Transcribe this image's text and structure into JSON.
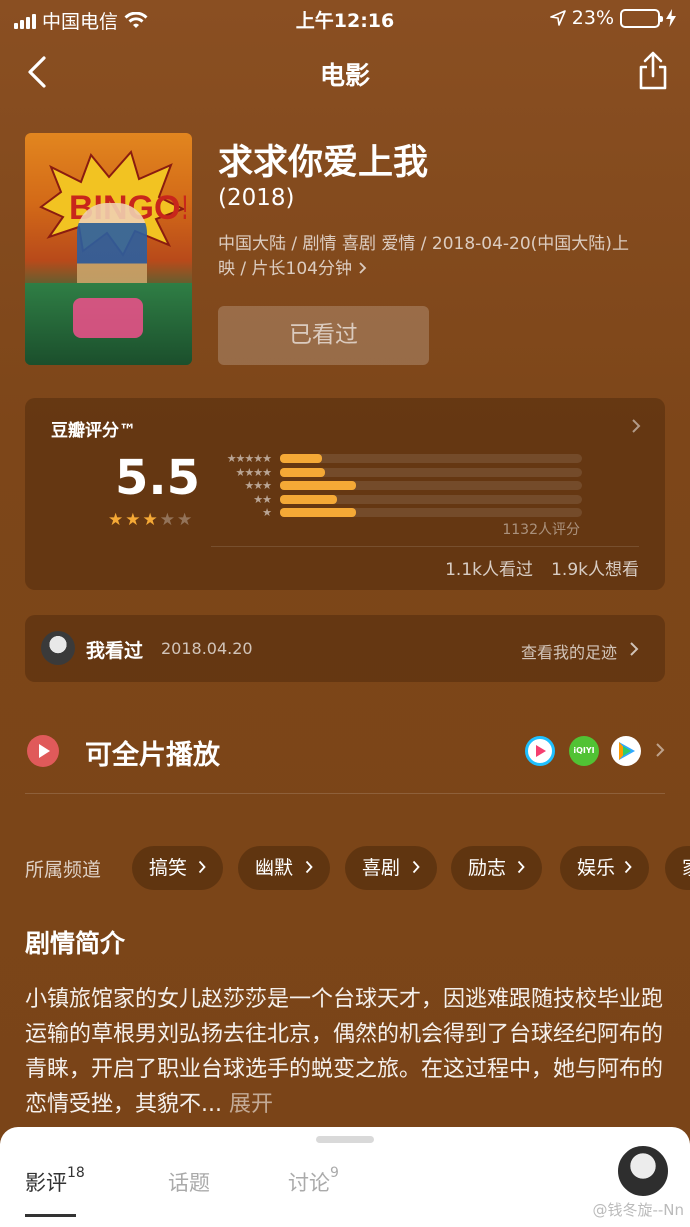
{
  "status_bar": {
    "carrier": "中国电信",
    "time": "上午12:16",
    "battery": "23%",
    "battery_level": 0.23
  },
  "nav": {
    "title": "电影"
  },
  "movie": {
    "title": "求求你爱上我",
    "year": "(2018)",
    "meta_line1": "中国大陆 / 剧情 喜剧 爱情 / 2018-04-20(中国大陆)上",
    "meta_line2": "映 / 片长104分钟",
    "status_button": "已看过"
  },
  "rating": {
    "label": "豆瓣评分™",
    "score": "5.5",
    "stars_filled": 3,
    "stars_total": 5,
    "distribution": [
      {
        "stars": "★★★★★",
        "fraction": 0.14
      },
      {
        "stars": "★★★★",
        "fraction": 0.15
      },
      {
        "stars": "★★★",
        "fraction": 0.25
      },
      {
        "stars": "★★",
        "fraction": 0.19
      },
      {
        "stars": "★",
        "fraction": 0.25
      }
    ],
    "count": "1132人评分",
    "seen": "1.1k人看过",
    "want": "1.9k人想看"
  },
  "my_mark": {
    "label": "我看过",
    "date": "2018.04.20",
    "link": "查看我的足迹"
  },
  "play": {
    "label": "可全片播放",
    "platform_2_text": "iQIYI"
  },
  "channels": {
    "label": "所属频道",
    "items": [
      "搞笑",
      "幽默",
      "喜剧",
      "励志",
      "娱乐",
      "家"
    ]
  },
  "synopsis": {
    "title": "剧情简介",
    "text": "小镇旅馆家的女儿赵莎莎是一个台球天才，因逃难跟随技校毕业跑运输的草根男刘弘扬去往北京，偶然的机会得到了台球经纪阿布的青睐，开启了职业台球选手的蜕变之旅。在这过程中，她与阿布的恋情受挫，其貌不...",
    "more": " 展开"
  },
  "bottom_tabs": [
    {
      "label": "影评",
      "count": "18"
    },
    {
      "label": "话题",
      "count": ""
    },
    {
      "label": "讨论",
      "count": "9"
    }
  ],
  "watermark": "@钱冬旋--Nn",
  "colors": {
    "accent": "#f5a936",
    "background": "#7d4619",
    "play": "#e05a5a"
  }
}
